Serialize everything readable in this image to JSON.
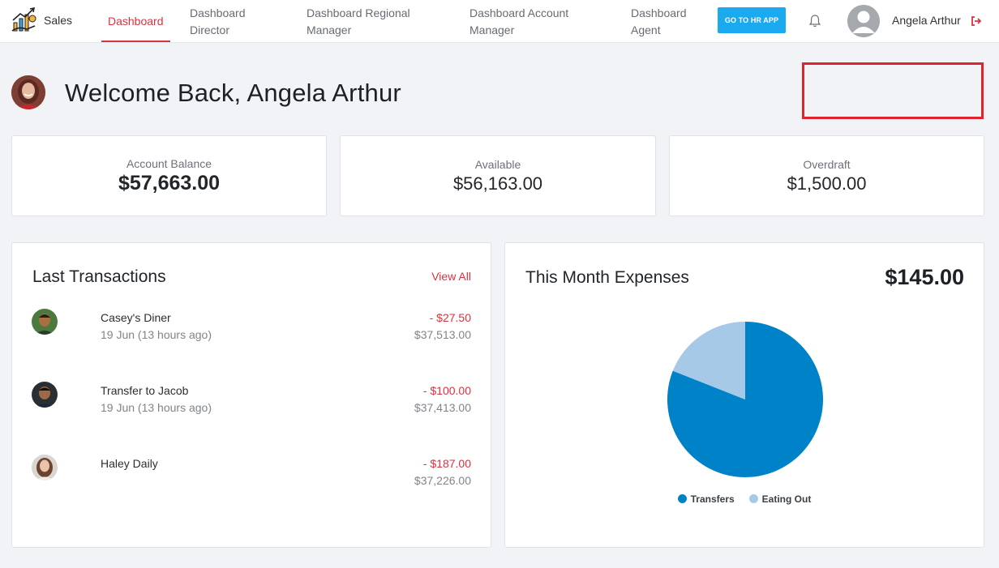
{
  "nav": {
    "brand": "Sales",
    "items": [
      {
        "label": "Dashboard",
        "active": true
      },
      {
        "label": "Dashboard\nDirector"
      },
      {
        "label": "Dashboard Regional\nManager"
      },
      {
        "label": "Dashboard Account\nManager"
      },
      {
        "label": "Dashboard\nAgent"
      }
    ],
    "hr_button": "GO TO HR APP",
    "user_name": "Angela Arthur",
    "icons": [
      "bell-icon",
      "logout-icon",
      "user-avatar",
      "sales-logo"
    ]
  },
  "welcome": {
    "title": "Welcome Back, Angela Arthur"
  },
  "stats": [
    {
      "label": "Account Balance",
      "value": "$57,663.00"
    },
    {
      "label": "Available",
      "value": "$56,163.00"
    },
    {
      "label": "Overdraft",
      "value": "$1,500.00"
    }
  ],
  "transactions": {
    "title": "Last Transactions",
    "view_all": "View All",
    "items": [
      {
        "name": "Casey's Diner",
        "date": "19 Jun (13 hours ago)",
        "amount": "- $27.50",
        "balance": "$37,513.00"
      },
      {
        "name": "Transfer to Jacob",
        "date": "19 Jun (13 hours ago)",
        "amount": "- $100.00",
        "balance": "$37,413.00"
      },
      {
        "name": "Haley Daily",
        "date": "",
        "amount": "- $187.00",
        "balance": "$37,226.00"
      }
    ]
  },
  "expenses": {
    "title": "This Month Expenses",
    "total": "$145.00"
  },
  "chart_data": {
    "type": "pie",
    "categories": [
      "Transfers",
      "Eating Out"
    ],
    "values": [
      81,
      19
    ],
    "colors": [
      "#0082c8",
      "#a5c9e7"
    ],
    "legend_position": "bottom"
  },
  "colors": {
    "accent": "#d9333f",
    "button": "#1ba9ef",
    "highlight_border": "#e0232c"
  }
}
